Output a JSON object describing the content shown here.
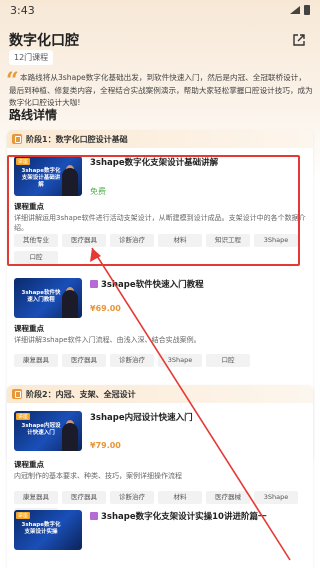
{
  "status": {
    "time": "3:43"
  },
  "header": {
    "title": "数字化口腔",
    "course_count": "12门课程",
    "intro": "本路线将从3shape数字化基础出发，到软件快速入门，然后是内冠、全冠联桥设计，最后到种植、修复类内容，全程结合实战案例演示，帮助大家轻松掌握口腔设计技巧，成为数字化口腔设计大咖!"
  },
  "section_title": "路线详情",
  "stages": [
    {
      "label": "阶段1：数字化口腔设计基础",
      "courses": [
        {
          "title": "3shape数字化支架设计基础讲解",
          "thumb_tag": "讲座",
          "thumb_text": "3shape数字化支架设计基础讲解",
          "price": "免费",
          "key_label": "课程重点",
          "desc": "详细讲解运用3shape软件进行活动支架设计，从断建模到设计成品。支架设计中的各个数据介绍。",
          "tags": [
            "其他专业",
            "医疗器具",
            "诊断治疗",
            "材料",
            "知识工程",
            "3Shape",
            "口腔"
          ]
        },
        {
          "title": "3shape软件快速入门教程",
          "thumb_tag": "",
          "thumb_text": "3shape软件快速入门教程",
          "price": "¥69.00",
          "key_label": "课程重点",
          "desc": "详细讲解3shape软件入门流程、由浅入深、结合实战案例。",
          "tags": [
            "康复器具",
            "医疗器具",
            "诊断治疗",
            "3Shape",
            "口腔"
          ]
        }
      ]
    },
    {
      "label": "阶段2：内冠、支架、全冠设计",
      "courses": [
        {
          "title": "3shape内冠设计快速入门",
          "thumb_tag": "讲座",
          "thumb_text": "3shape内冠设计快速入门",
          "price": "¥79.00",
          "key_label": "课程重点",
          "desc": "内冠制作的基本要求、种类、技巧，案例详细操作流程",
          "tags": [
            "康复器具",
            "医疗器具",
            "诊断治疗",
            "材料",
            "医疗器械",
            "3Shape",
            "口腔"
          ]
        },
        {
          "title": "3shape数字化支架设计实操10讲进阶篇一",
          "thumb_tag": "讲座",
          "thumb_text": "3shape数字化支架设计实操",
          "price": "",
          "key_label": "",
          "desc": "",
          "tags": []
        }
      ]
    }
  ],
  "colors": {
    "accent": "#e8953a",
    "free": "#4caf50",
    "highlight": "#e53935"
  }
}
